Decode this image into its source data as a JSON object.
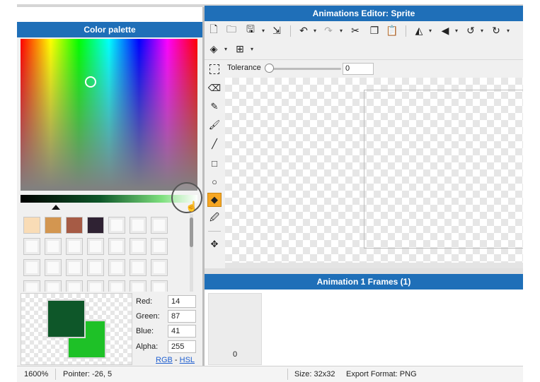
{
  "window": {
    "title": "Animations Editor: Sprite"
  },
  "color_palette": {
    "title": "Color palette",
    "swatches": [
      "#f9dcb6",
      "#d39650",
      "#a65b45",
      "#2f2233"
    ],
    "empty_swatch_count": 24
  },
  "color_editor": {
    "primary_color": "#0e5729",
    "secondary_color": "#1ec127",
    "fields": {
      "red": {
        "label": "Red:",
        "value": "14"
      },
      "green": {
        "label": "Green:",
        "value": "87"
      },
      "blue": {
        "label": "Blue:",
        "value": "41"
      },
      "alpha": {
        "label": "Alpha:",
        "value": "255"
      }
    },
    "mode_links": {
      "rgb": "RGB",
      "dash": "-",
      "hsl": "HSL"
    }
  },
  "toolbar": {
    "icons": [
      "new-file-icon",
      "open-folder-icon",
      "save-icon",
      "export-icon",
      "undo-icon",
      "redo-icon",
      "cut-icon",
      "copy-icon",
      "paste-icon",
      "flip-horizontal-icon",
      "flip-vertical-icon",
      "rotate-left-icon",
      "rotate-right-icon",
      "layers-icon",
      "grid-icon"
    ]
  },
  "tool_options": {
    "tolerance_label": "Tolerance",
    "tolerance_value": "0"
  },
  "tools": [
    "select-icon",
    "eraser-icon",
    "pencil-icon",
    "brush-icon",
    "line-icon",
    "rectangle-icon",
    "ellipse-icon",
    "fill-bucket-icon",
    "eyedropper-icon",
    "move-icon"
  ],
  "frames": {
    "title": "Animation 1 Frames (1)",
    "items": [
      {
        "index": "0"
      }
    ]
  },
  "status_bar": {
    "zoom": "1600%",
    "pointer": "Pointer: -26, 5",
    "size": "Size: 32x32",
    "export_format": "Export Format: PNG"
  },
  "colors": {
    "accent": "#1f6fb8",
    "active_tool": "#f5a623"
  }
}
